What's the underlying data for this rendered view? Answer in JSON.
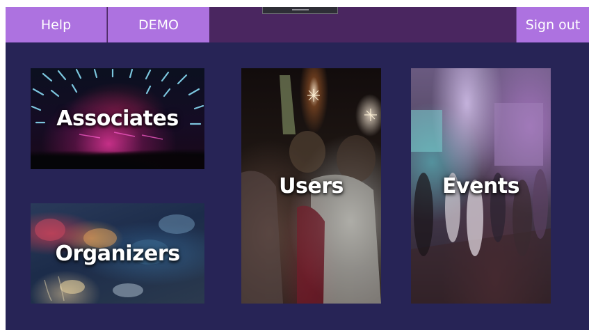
{
  "topbar": {
    "help_label": "Help",
    "demo_label": "DEMO",
    "signout_label": "Sign out"
  },
  "tiles": {
    "associates": "Associates",
    "organizers": "Organizers",
    "users": "Users",
    "events": "Events"
  },
  "colors": {
    "background": "#272456",
    "topbar": "#4a2660",
    "button": "#ad72e0"
  }
}
